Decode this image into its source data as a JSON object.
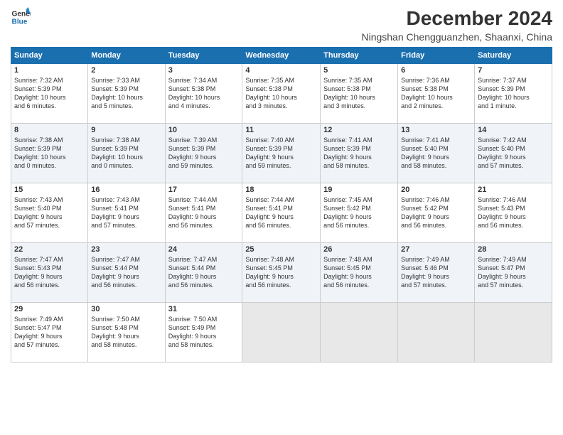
{
  "logo": {
    "line1": "General",
    "line2": "Blue"
  },
  "title": "December 2024",
  "location": "Ningshan Chengguanzhen, Shaanxi, China",
  "headers": [
    "Sunday",
    "Monday",
    "Tuesday",
    "Wednesday",
    "Thursday",
    "Friday",
    "Saturday"
  ],
  "weeks": [
    [
      {
        "day": "1",
        "info": "Sunrise: 7:32 AM\nSunset: 5:39 PM\nDaylight: 10 hours\nand 6 minutes."
      },
      {
        "day": "2",
        "info": "Sunrise: 7:33 AM\nSunset: 5:39 PM\nDaylight: 10 hours\nand 5 minutes."
      },
      {
        "day": "3",
        "info": "Sunrise: 7:34 AM\nSunset: 5:38 PM\nDaylight: 10 hours\nand 4 minutes."
      },
      {
        "day": "4",
        "info": "Sunrise: 7:35 AM\nSunset: 5:38 PM\nDaylight: 10 hours\nand 3 minutes."
      },
      {
        "day": "5",
        "info": "Sunrise: 7:35 AM\nSunset: 5:38 PM\nDaylight: 10 hours\nand 3 minutes."
      },
      {
        "day": "6",
        "info": "Sunrise: 7:36 AM\nSunset: 5:38 PM\nDaylight: 10 hours\nand 2 minutes."
      },
      {
        "day": "7",
        "info": "Sunrise: 7:37 AM\nSunset: 5:39 PM\nDaylight: 10 hours\nand 1 minute."
      }
    ],
    [
      {
        "day": "8",
        "info": "Sunrise: 7:38 AM\nSunset: 5:39 PM\nDaylight: 10 hours\nand 0 minutes."
      },
      {
        "day": "9",
        "info": "Sunrise: 7:38 AM\nSunset: 5:39 PM\nDaylight: 10 hours\nand 0 minutes."
      },
      {
        "day": "10",
        "info": "Sunrise: 7:39 AM\nSunset: 5:39 PM\nDaylight: 9 hours\nand 59 minutes."
      },
      {
        "day": "11",
        "info": "Sunrise: 7:40 AM\nSunset: 5:39 PM\nDaylight: 9 hours\nand 59 minutes."
      },
      {
        "day": "12",
        "info": "Sunrise: 7:41 AM\nSunset: 5:39 PM\nDaylight: 9 hours\nand 58 minutes."
      },
      {
        "day": "13",
        "info": "Sunrise: 7:41 AM\nSunset: 5:40 PM\nDaylight: 9 hours\nand 58 minutes."
      },
      {
        "day": "14",
        "info": "Sunrise: 7:42 AM\nSunset: 5:40 PM\nDaylight: 9 hours\nand 57 minutes."
      }
    ],
    [
      {
        "day": "15",
        "info": "Sunrise: 7:43 AM\nSunset: 5:40 PM\nDaylight: 9 hours\nand 57 minutes."
      },
      {
        "day": "16",
        "info": "Sunrise: 7:43 AM\nSunset: 5:41 PM\nDaylight: 9 hours\nand 57 minutes."
      },
      {
        "day": "17",
        "info": "Sunrise: 7:44 AM\nSunset: 5:41 PM\nDaylight: 9 hours\nand 56 minutes."
      },
      {
        "day": "18",
        "info": "Sunrise: 7:44 AM\nSunset: 5:41 PM\nDaylight: 9 hours\nand 56 minutes."
      },
      {
        "day": "19",
        "info": "Sunrise: 7:45 AM\nSunset: 5:42 PM\nDaylight: 9 hours\nand 56 minutes."
      },
      {
        "day": "20",
        "info": "Sunrise: 7:46 AM\nSunset: 5:42 PM\nDaylight: 9 hours\nand 56 minutes."
      },
      {
        "day": "21",
        "info": "Sunrise: 7:46 AM\nSunset: 5:43 PM\nDaylight: 9 hours\nand 56 minutes."
      }
    ],
    [
      {
        "day": "22",
        "info": "Sunrise: 7:47 AM\nSunset: 5:43 PM\nDaylight: 9 hours\nand 56 minutes."
      },
      {
        "day": "23",
        "info": "Sunrise: 7:47 AM\nSunset: 5:44 PM\nDaylight: 9 hours\nand 56 minutes."
      },
      {
        "day": "24",
        "info": "Sunrise: 7:47 AM\nSunset: 5:44 PM\nDaylight: 9 hours\nand 56 minutes."
      },
      {
        "day": "25",
        "info": "Sunrise: 7:48 AM\nSunset: 5:45 PM\nDaylight: 9 hours\nand 56 minutes."
      },
      {
        "day": "26",
        "info": "Sunrise: 7:48 AM\nSunset: 5:45 PM\nDaylight: 9 hours\nand 56 minutes."
      },
      {
        "day": "27",
        "info": "Sunrise: 7:49 AM\nSunset: 5:46 PM\nDaylight: 9 hours\nand 57 minutes."
      },
      {
        "day": "28",
        "info": "Sunrise: 7:49 AM\nSunset: 5:47 PM\nDaylight: 9 hours\nand 57 minutes."
      }
    ],
    [
      {
        "day": "29",
        "info": "Sunrise: 7:49 AM\nSunset: 5:47 PM\nDaylight: 9 hours\nand 57 minutes."
      },
      {
        "day": "30",
        "info": "Sunrise: 7:50 AM\nSunset: 5:48 PM\nDaylight: 9 hours\nand 58 minutes."
      },
      {
        "day": "31",
        "info": "Sunrise: 7:50 AM\nSunset: 5:49 PM\nDaylight: 9 hours\nand 58 minutes."
      },
      null,
      null,
      null,
      null
    ]
  ]
}
